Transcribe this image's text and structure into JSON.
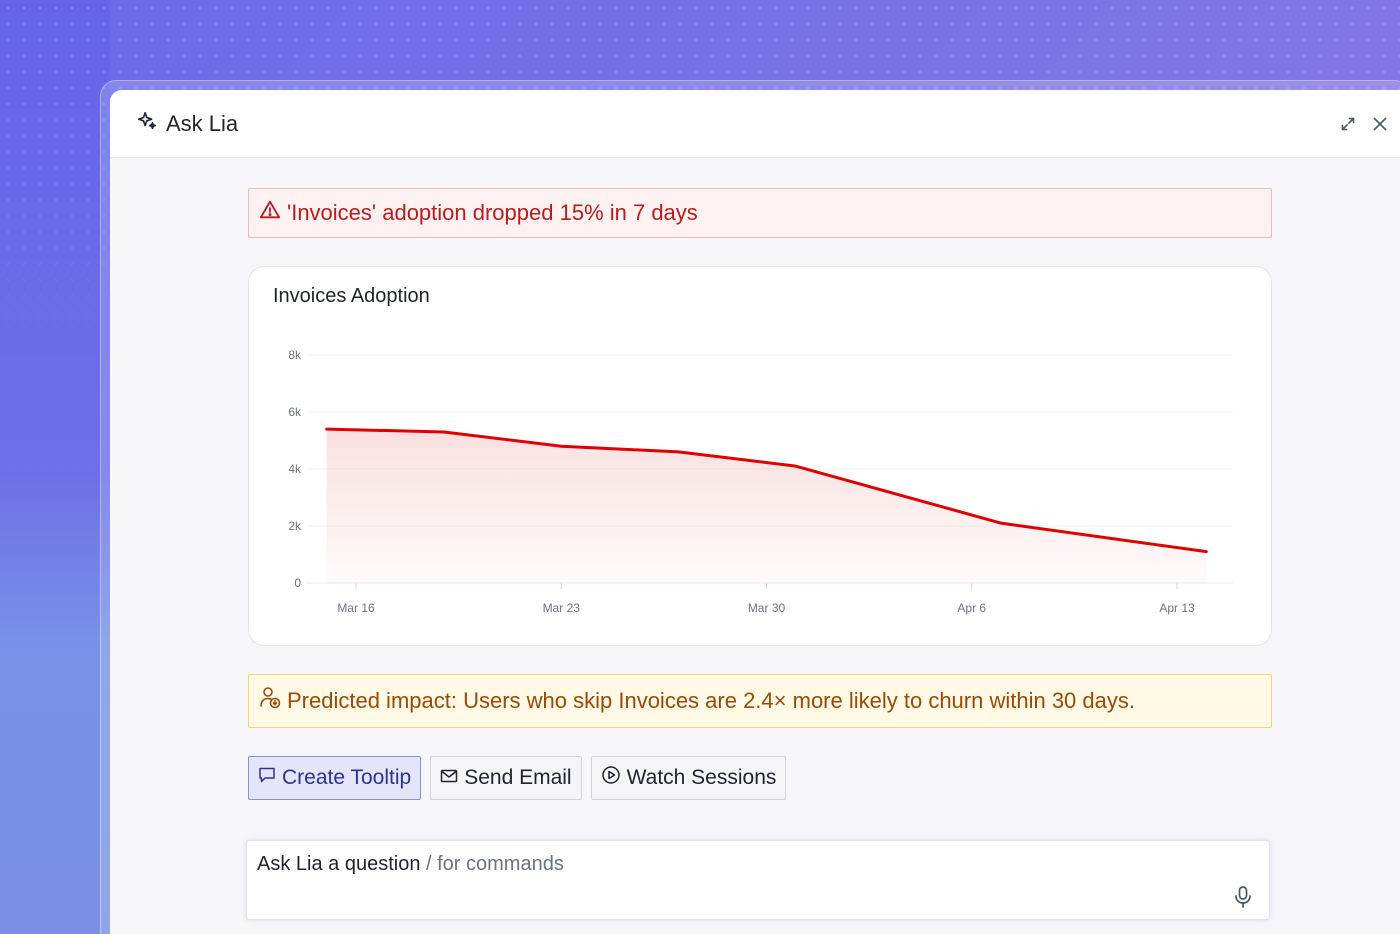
{
  "window": {
    "title": "Ask Lia"
  },
  "alert": {
    "text": "'Invoices' adoption dropped 15% in 7 days",
    "color": "#b91c1c"
  },
  "chart_data": {
    "type": "area",
    "title": "Invoices Adoption",
    "xlabel": "",
    "ylabel": "",
    "x_ticks": [
      "Mar 16",
      "Mar 23",
      "Mar 30",
      "Apr 6",
      "Apr 13"
    ],
    "y_ticks": [
      "0",
      "2k",
      "4k",
      "6k",
      "8k"
    ],
    "ylim": [
      0,
      8000
    ],
    "grid": true,
    "series": [
      {
        "color": "#e00000",
        "x": [
          "Mar 15",
          "Mar 19",
          "Mar 23",
          "Mar 27",
          "Mar 31",
          "Apr 7",
          "Apr 14"
        ],
        "values": [
          5400,
          5300,
          4800,
          4600,
          4100,
          2100,
          1100
        ]
      }
    ]
  },
  "impact": {
    "text": "Predicted impact: Users who skip Invoices are 2.4× more likely to churn within 30 days.",
    "color": "#9a4a06"
  },
  "actions": {
    "create_tooltip": "Create Tooltip",
    "send_email": "Send Email",
    "watch_sessions": "Watch Sessions"
  },
  "ask": {
    "placeholder_main": "Ask Lia a question",
    "placeholder_hint": "/ for commands"
  }
}
